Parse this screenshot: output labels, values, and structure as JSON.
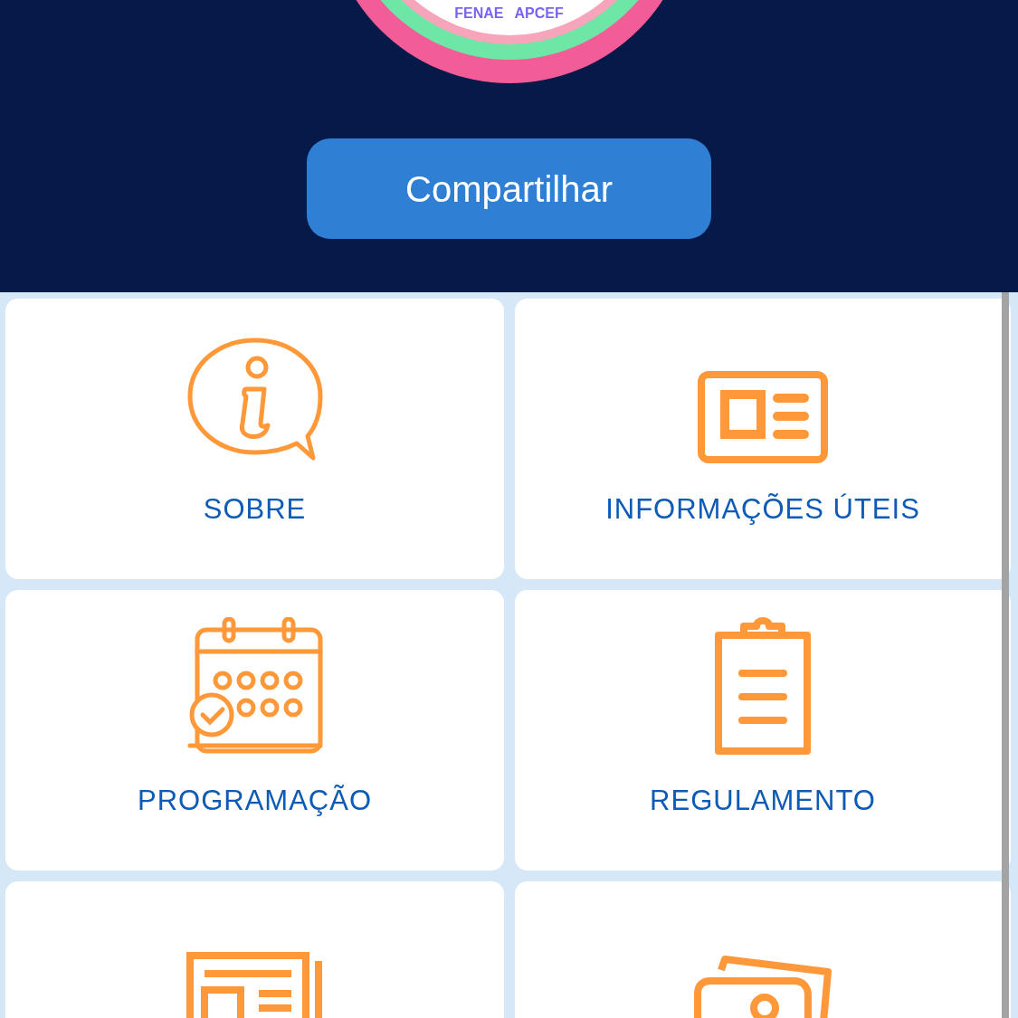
{
  "logo": {
    "texts": [
      "FENAE",
      "APCEF"
    ]
  },
  "share_button": {
    "label": "Compartilhar"
  },
  "menu_tiles": [
    {
      "kind": "full",
      "label": "SOBRE"
    },
    {
      "kind": "full",
      "label": "INFORMAÇÕES ÚTEIS"
    },
    {
      "kind": "full",
      "label": "PROGRAMAÇÃO"
    },
    {
      "kind": "full",
      "label": "REGULAMENTO"
    },
    {
      "kind": "partial"
    },
    {
      "kind": "partial"
    }
  ]
}
